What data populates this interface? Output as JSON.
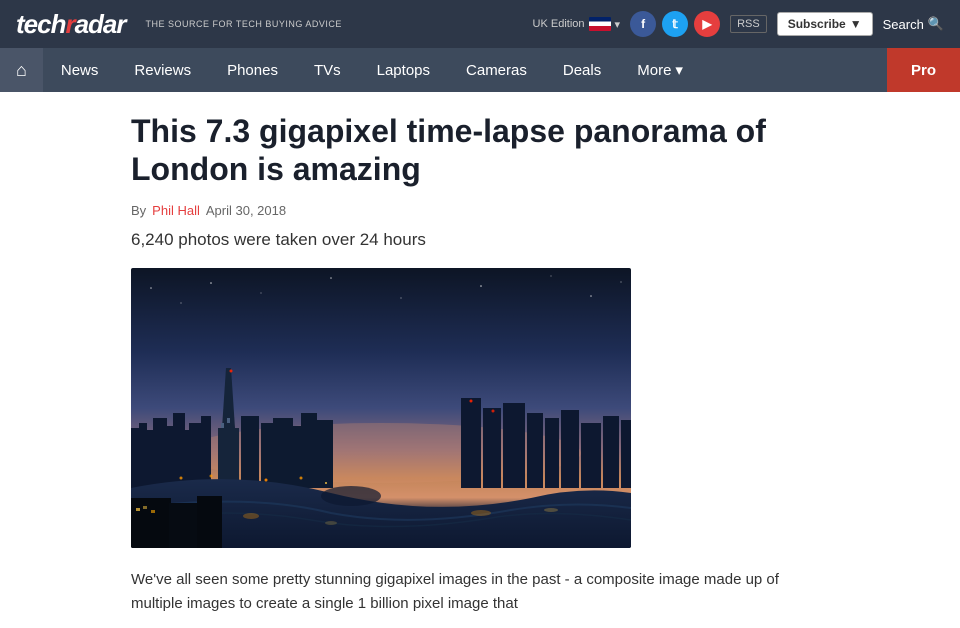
{
  "site": {
    "logo": "techradar",
    "logo_accent": "r",
    "tagline": "THE SOURCE FOR TECH BUYING ADVICE"
  },
  "topbar": {
    "edition": "UK Edition",
    "rss": "RSS",
    "subscribe": "Subscribe",
    "subscribe_arrow": "▼",
    "search": "Search",
    "search_icon": "🔍"
  },
  "social": [
    {
      "name": "facebook",
      "label": "f",
      "class": "fb"
    },
    {
      "name": "twitter",
      "label": "t",
      "class": "tw"
    },
    {
      "name": "youtube",
      "label": "▶",
      "class": "yt"
    }
  ],
  "nav": {
    "home_icon": "⌂",
    "items": [
      {
        "label": "News",
        "id": "news"
      },
      {
        "label": "Reviews",
        "id": "reviews"
      },
      {
        "label": "Phones",
        "id": "phones"
      },
      {
        "label": "TVs",
        "id": "tvs"
      },
      {
        "label": "Laptops",
        "id": "laptops"
      },
      {
        "label": "Cameras",
        "id": "cameras"
      },
      {
        "label": "Deals",
        "id": "deals"
      },
      {
        "label": "More ▾",
        "id": "more"
      }
    ],
    "pro": "Pro"
  },
  "article": {
    "title": "This 7.3 gigapixel time-lapse panorama of London is amazing",
    "by_label": "By",
    "author": "Phil Hall",
    "date": "April 30, 2018",
    "subtitle": "6,240 photos were taken over 24 hours",
    "body1": "We've all seen some pretty stunning gigapixel images in the past - a composite image made up of multiple images to create a single 1 billion pixel image that",
    "image_alt": "London cityscape panorama at dusk"
  }
}
